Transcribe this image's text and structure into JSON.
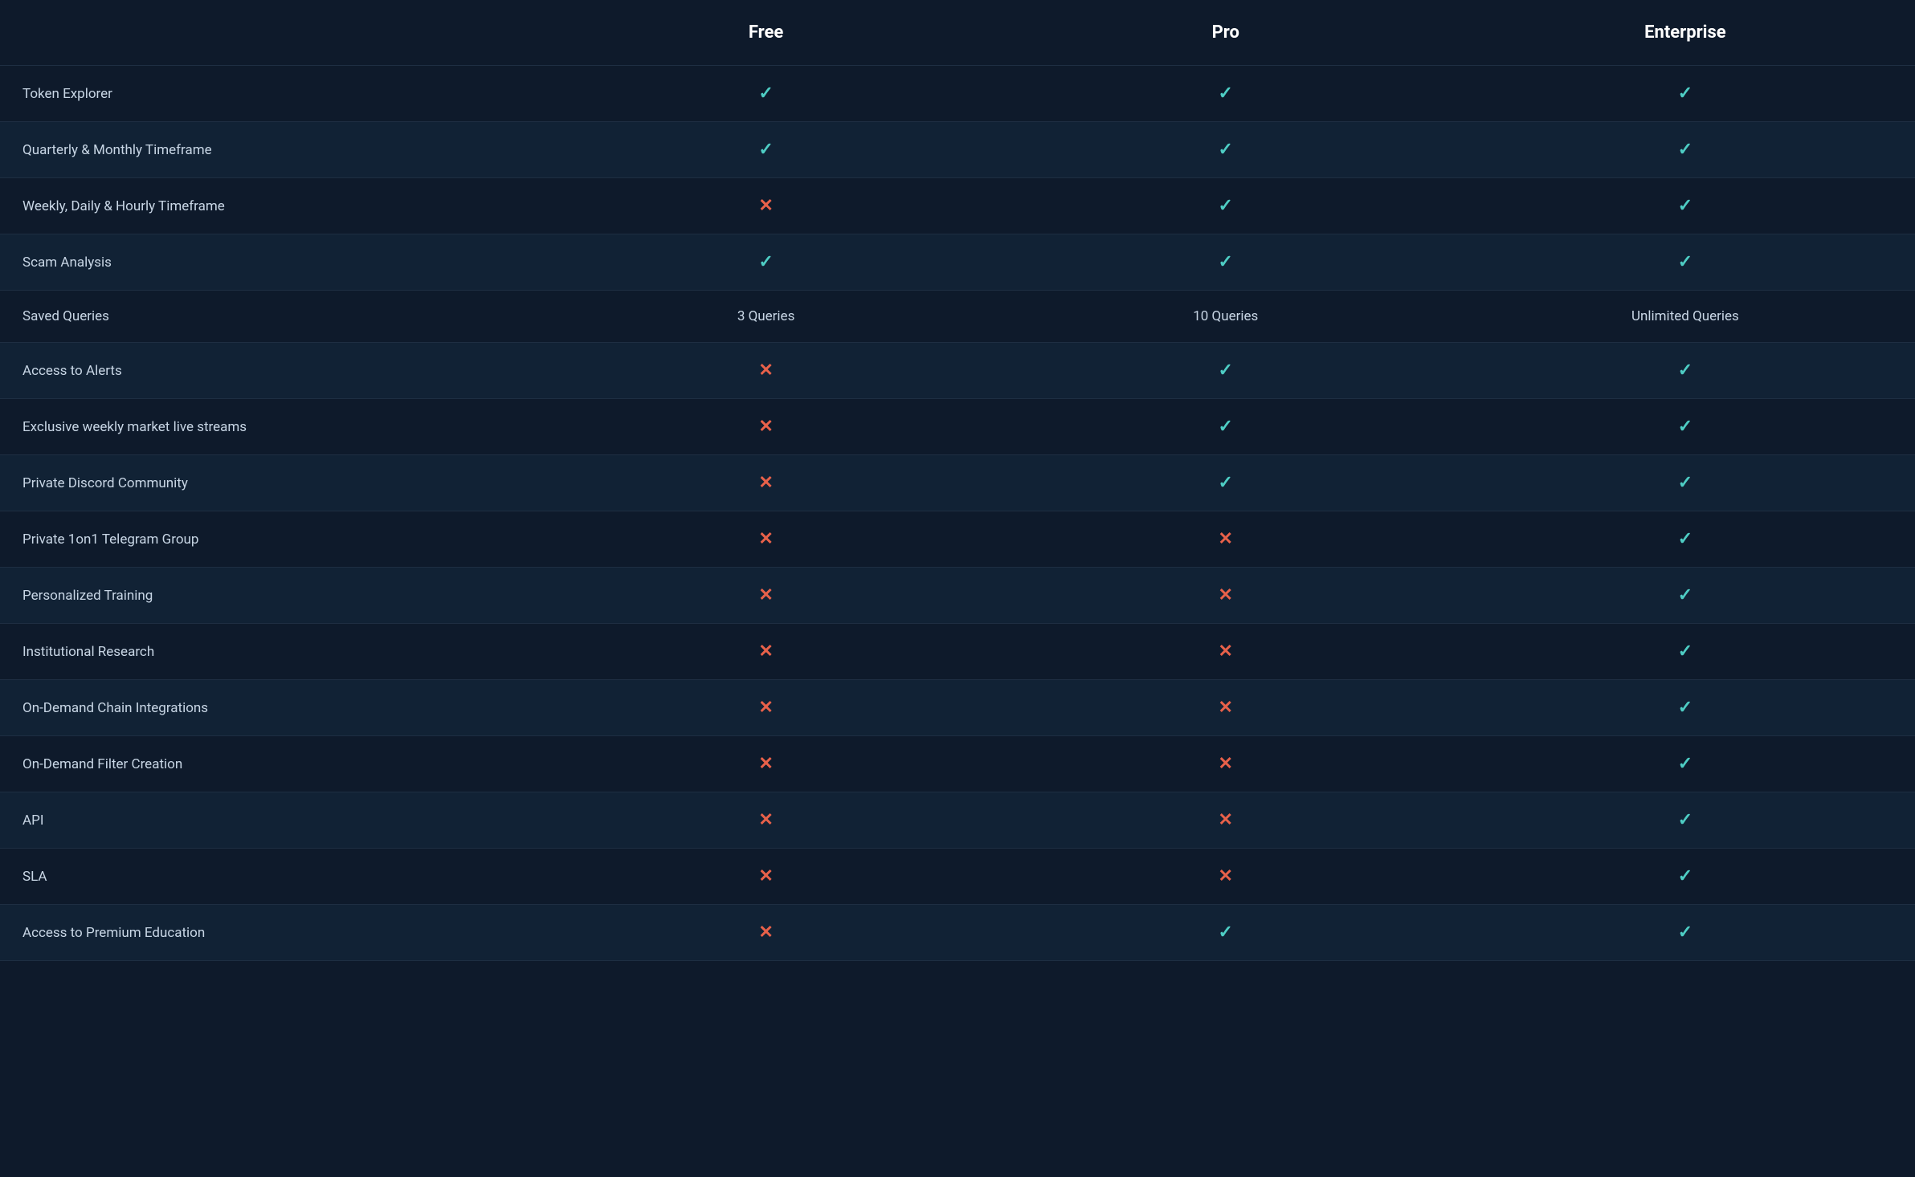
{
  "header": {
    "col_feature": "",
    "col_free": "Free",
    "col_pro": "Pro",
    "col_enterprise": "Enterprise"
  },
  "rows": [
    {
      "feature": "Token Explorer",
      "free": "check",
      "pro": "check",
      "enterprise": "check"
    },
    {
      "feature": "Quarterly & Monthly Timeframe",
      "free": "check",
      "pro": "check",
      "enterprise": "check"
    },
    {
      "feature": "Weekly, Daily & Hourly Timeframe",
      "free": "cross",
      "pro": "check",
      "enterprise": "check"
    },
    {
      "feature": "Scam Analysis",
      "free": "check",
      "pro": "check",
      "enterprise": "check"
    },
    {
      "feature": "Saved Queries",
      "free": "3 Queries",
      "pro": "10 Queries",
      "enterprise": "Unlimited Queries"
    },
    {
      "feature": "Access to Alerts",
      "free": "cross",
      "pro": "check",
      "enterprise": "check"
    },
    {
      "feature": "Exclusive weekly market live streams",
      "free": "cross",
      "pro": "check",
      "enterprise": "check"
    },
    {
      "feature": "Private Discord Community",
      "free": "cross",
      "pro": "check",
      "enterprise": "check"
    },
    {
      "feature": "Private 1on1 Telegram Group",
      "free": "cross",
      "pro": "cross",
      "enterprise": "check"
    },
    {
      "feature": "Personalized Training",
      "free": "cross",
      "pro": "cross",
      "enterprise": "check"
    },
    {
      "feature": "Institutional Research",
      "free": "cross",
      "pro": "cross",
      "enterprise": "check"
    },
    {
      "feature": "On-Demand Chain Integrations",
      "free": "cross",
      "pro": "cross",
      "enterprise": "check"
    },
    {
      "feature": "On-Demand Filter Creation",
      "free": "cross",
      "pro": "cross",
      "enterprise": "check"
    },
    {
      "feature": "API",
      "free": "cross",
      "pro": "cross",
      "enterprise": "check"
    },
    {
      "feature": "SLA",
      "free": "cross",
      "pro": "cross",
      "enterprise": "check"
    },
    {
      "feature": "Access to Premium Education",
      "free": "cross",
      "pro": "check",
      "enterprise": "check"
    }
  ],
  "symbols": {
    "check": "✓",
    "cross": "✕"
  }
}
